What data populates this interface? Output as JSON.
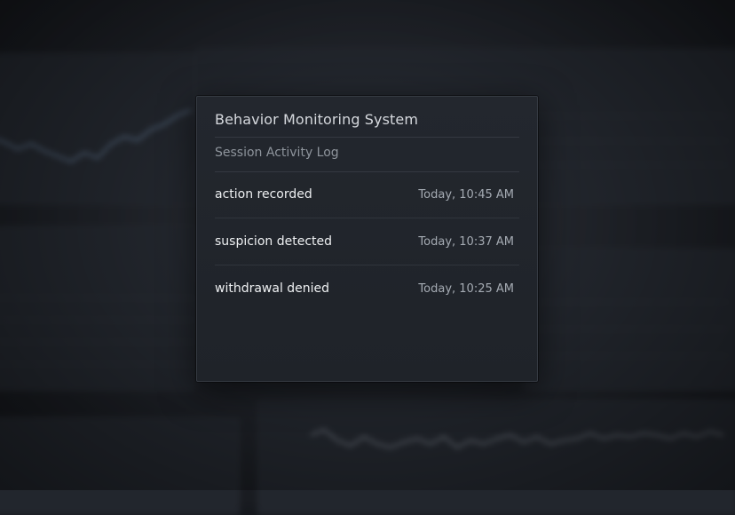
{
  "modal": {
    "title": "Behavior Monitoring System",
    "subtitle": "Session Activity Log",
    "entries": [
      {
        "action": "action recorded",
        "time": "Today, 10:45 AM"
      },
      {
        "action": "suspicion detected",
        "time": "Today, 10:37 AM"
      },
      {
        "action": "withdrawal denied",
        "time": "Today, 10:25 AM"
      }
    ]
  },
  "colors": {
    "background": "#16191e",
    "modal_background": "#22262d",
    "title_text": "#d6d9de",
    "subtitle_text": "#8e949c",
    "entry_text": "#eef0f2",
    "time_text": "#a5abb3"
  }
}
